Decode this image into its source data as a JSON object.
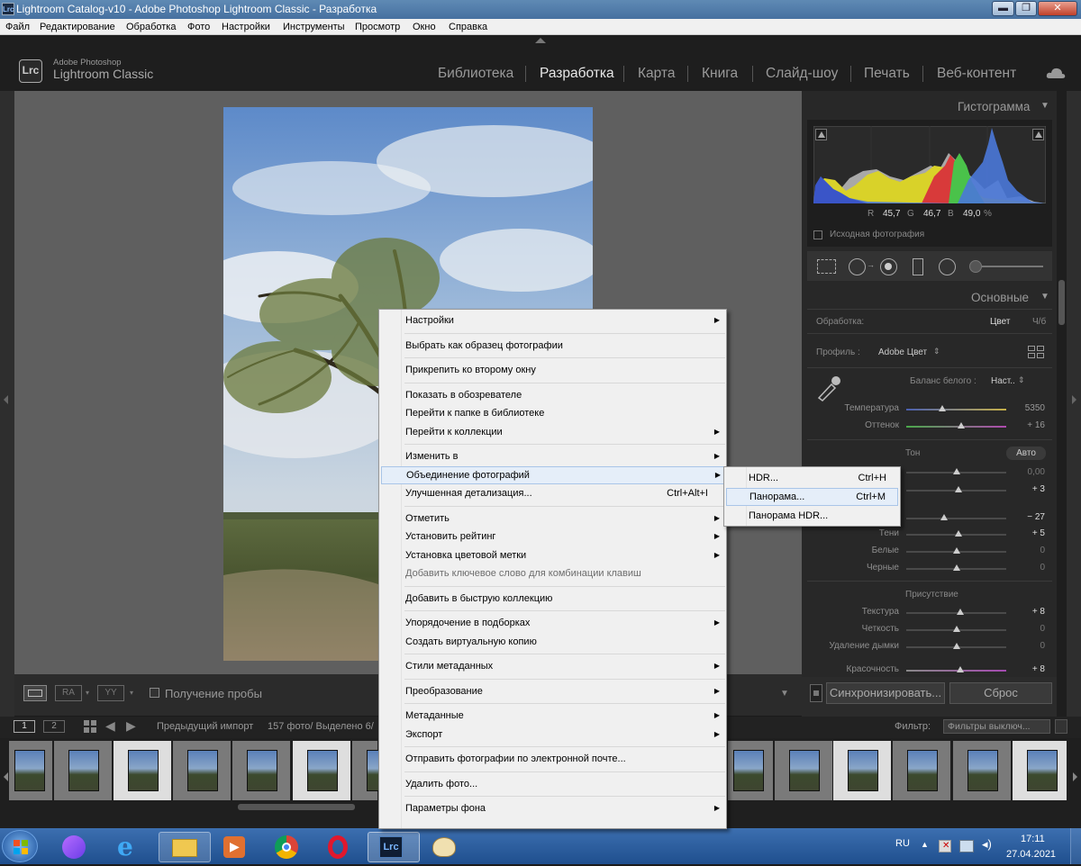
{
  "window": {
    "title": "Lightroom Catalog-v10 - Adobe Photoshop Lightroom Classic - Разработка",
    "app_icon": "Lrc",
    "min": "▬",
    "max": "❐",
    "close": "✕"
  },
  "menubar": [
    "Файл",
    "Редактирование",
    "Обработка",
    "Фото",
    "Настройки",
    "Инструменты",
    "Просмотр",
    "Окно",
    "Справка"
  ],
  "header": {
    "logo": "Lrc",
    "sub": "Adobe Photoshop",
    "name": "Lightroom Classic",
    "modules": [
      "Библиотека",
      "Разработка",
      "Карта",
      "Книга",
      "Слайд-шоу",
      "Печать",
      "Веб-контент"
    ],
    "active_module": "Разработка"
  },
  "histogram": {
    "title": "Гистограмма",
    "readout": {
      "r_label": "R",
      "r": "45,7",
      "g_label": "G",
      "g": "46,7",
      "b_label": "B",
      "b": "49,0",
      "unit": "%"
    },
    "original_label": "Исходная фотография"
  },
  "basic": {
    "title": "Основные",
    "treatment_label": "Обработка:",
    "treatment_color": "Цвет",
    "treatment_bw": "Ч/б",
    "profile_label": "Профиль :",
    "profile_value": "Adobe Цвет",
    "wb_label": "Баланс белого :",
    "wb_value": "Наст..",
    "temp_label": "Температура",
    "temp_value": "5350",
    "tint_label": "Оттенок",
    "tint_value": "+ 16",
    "tone_label": "Тон",
    "auto_label": "Авто",
    "exposure_value": "0,00",
    "contrast_value": "+ 3",
    "highlights_value": "− 27",
    "shadows_label": "Тени",
    "shadows_value": "+ 5",
    "whites_label": "Белые",
    "whites_value": "0",
    "blacks_label": "Черные",
    "blacks_value": "0",
    "presence_label": "Присутствие",
    "texture_label": "Текстура",
    "texture_value": "+ 8",
    "clarity_label": "Четкость",
    "clarity_value": "0",
    "dehaze_label": "Удаление дымки",
    "dehaze_value": "0",
    "vibrance_label": "Красочность",
    "vibrance_value": "+ 8"
  },
  "panel_buttons": {
    "sync": "Синхронизировать...",
    "reset": "Сброс"
  },
  "toolbar": {
    "proof_label": "Получение пробы",
    "ra": "RA",
    "yy": "YY"
  },
  "filmbar": {
    "page1": "1",
    "page2": "2",
    "source": "Предыдущий импорт",
    "count": "157 фото/ Выделено 6/",
    "filter_label": "Фильтр:",
    "filter_value": "Фильтры выключ..."
  },
  "context_menu": [
    {
      "label": "Настройки",
      "arrow": true
    },
    {
      "sep": true
    },
    {
      "label": "Выбрать как образец фотографии"
    },
    {
      "sep": true
    },
    {
      "label": "Прикрепить ко второму окну"
    },
    {
      "sep": true
    },
    {
      "label": "Показать в обозревателе"
    },
    {
      "label": "Перейти к папке в библиотеке"
    },
    {
      "label": "Перейти к коллекции",
      "arrow": true
    },
    {
      "sep": true
    },
    {
      "label": "Изменить в",
      "arrow": true
    },
    {
      "label": "Объединение фотографий",
      "arrow": true,
      "highlight": true
    },
    {
      "label": "Улучшенная детализация...",
      "shortcut": "Ctrl+Alt+I"
    },
    {
      "sep": true
    },
    {
      "label": "Отметить",
      "arrow": true
    },
    {
      "label": "Установить рейтинг",
      "arrow": true
    },
    {
      "label": "Установка цветовой метки",
      "arrow": true
    },
    {
      "label": "Добавить ключевое слово для комбинации клавиш",
      "disabled": true
    },
    {
      "sep": true
    },
    {
      "label": "Добавить в быструю коллекцию"
    },
    {
      "sep": true
    },
    {
      "label": "Упорядочение в подборках",
      "arrow": true
    },
    {
      "label": "Создать виртуальную копию"
    },
    {
      "sep": true
    },
    {
      "label": "Стили метаданных",
      "arrow": true
    },
    {
      "sep": true
    },
    {
      "label": "Преобразование",
      "arrow": true
    },
    {
      "sep": true
    },
    {
      "label": "Метаданные",
      "arrow": true
    },
    {
      "label": "Экспорт",
      "arrow": true
    },
    {
      "sep": true
    },
    {
      "label": "Отправить фотографии по электронной почте..."
    },
    {
      "sep": true
    },
    {
      "label": "Удалить фото..."
    },
    {
      "sep": true
    },
    {
      "label": "Параметры фона",
      "arrow": true
    }
  ],
  "submenu": [
    {
      "label": "HDR...",
      "shortcut": "Ctrl+H"
    },
    {
      "label": "Панорама...",
      "shortcut": "Ctrl+M",
      "highlight": true
    },
    {
      "label": "Панорама HDR..."
    }
  ],
  "taskbar": {
    "lang": "RU",
    "time": "17:11",
    "date": "27.04.2021"
  },
  "colors": {
    "accent_blue": "#a9c5e8",
    "lr_bg": "#282828"
  }
}
